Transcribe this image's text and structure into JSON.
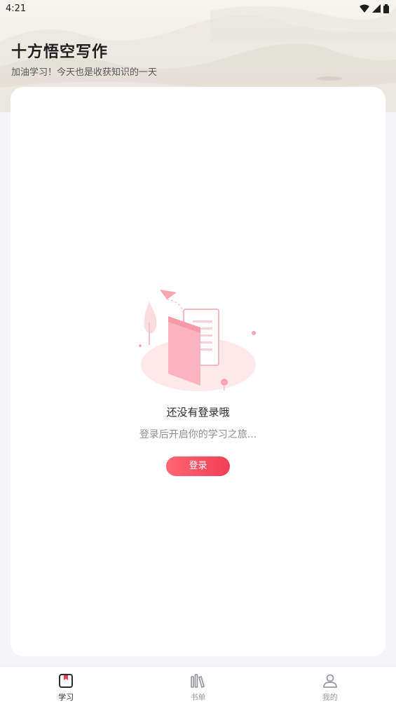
{
  "status_bar": {
    "time": "4:21"
  },
  "header": {
    "title": "十方悟空写作",
    "subtitle": "加油学习！今天也是收获知识的一天"
  },
  "empty_state": {
    "title": "还没有登录哦",
    "description": "登录后开启你的学习之旅...",
    "login_label": "登录"
  },
  "tabbar": {
    "items": [
      {
        "label": "学习",
        "icon": "study-icon",
        "active": true
      },
      {
        "label": "书单",
        "icon": "booklist-icon",
        "active": false
      },
      {
        "label": "我的",
        "icon": "profile-icon",
        "active": false
      }
    ]
  },
  "colors": {
    "accent": "#f23f55",
    "background": "#f5f5f7",
    "card": "#ffffff"
  }
}
